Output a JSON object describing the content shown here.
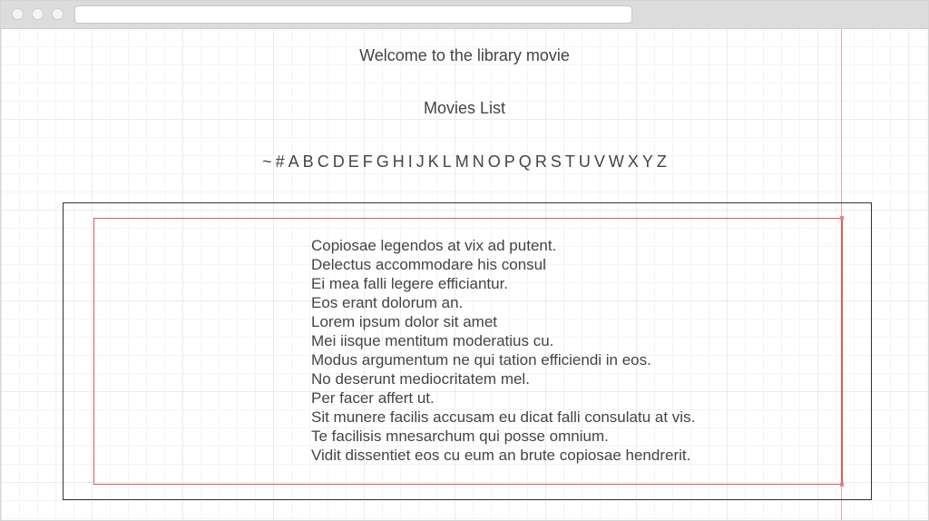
{
  "browser": {
    "url": ""
  },
  "page": {
    "welcome": "Welcome to the library movie",
    "list_title": "Movies List"
  },
  "alpha_nav": [
    "~",
    "#",
    "A",
    "B",
    "C",
    "D",
    "E",
    "F",
    "G",
    "H",
    "I",
    "J",
    "K",
    "L",
    "M",
    "N",
    "O",
    "P",
    "Q",
    "R",
    "S",
    "T",
    "U",
    "V",
    "W",
    "X",
    "Y",
    "Z"
  ],
  "movies": [
    "Copiosae legendos at vix ad putent.",
    "Delectus accommodare his consul",
    "Ei mea falli legere efficiantur.",
    "Eos erant dolorum an.",
    "Lorem ipsum dolor sit amet",
    "Mei iisque mentitum moderatius cu.",
    "Modus argumentum ne qui tation efficiendi in eos.",
    "No deserunt mediocritatem mel.",
    "Per facer affert ut.",
    "Sit munere facilis accusam eu dicat falli consulatu at vis.",
    "Te facilisis mnesarchum qui posse omnium.",
    "Vidit dissentiet eos cu eum an brute copiosae hendrerit."
  ],
  "colors": {
    "text": "#444444",
    "selection": "#e05a5a",
    "frame": "#333333",
    "grid": "#ebebeb"
  }
}
